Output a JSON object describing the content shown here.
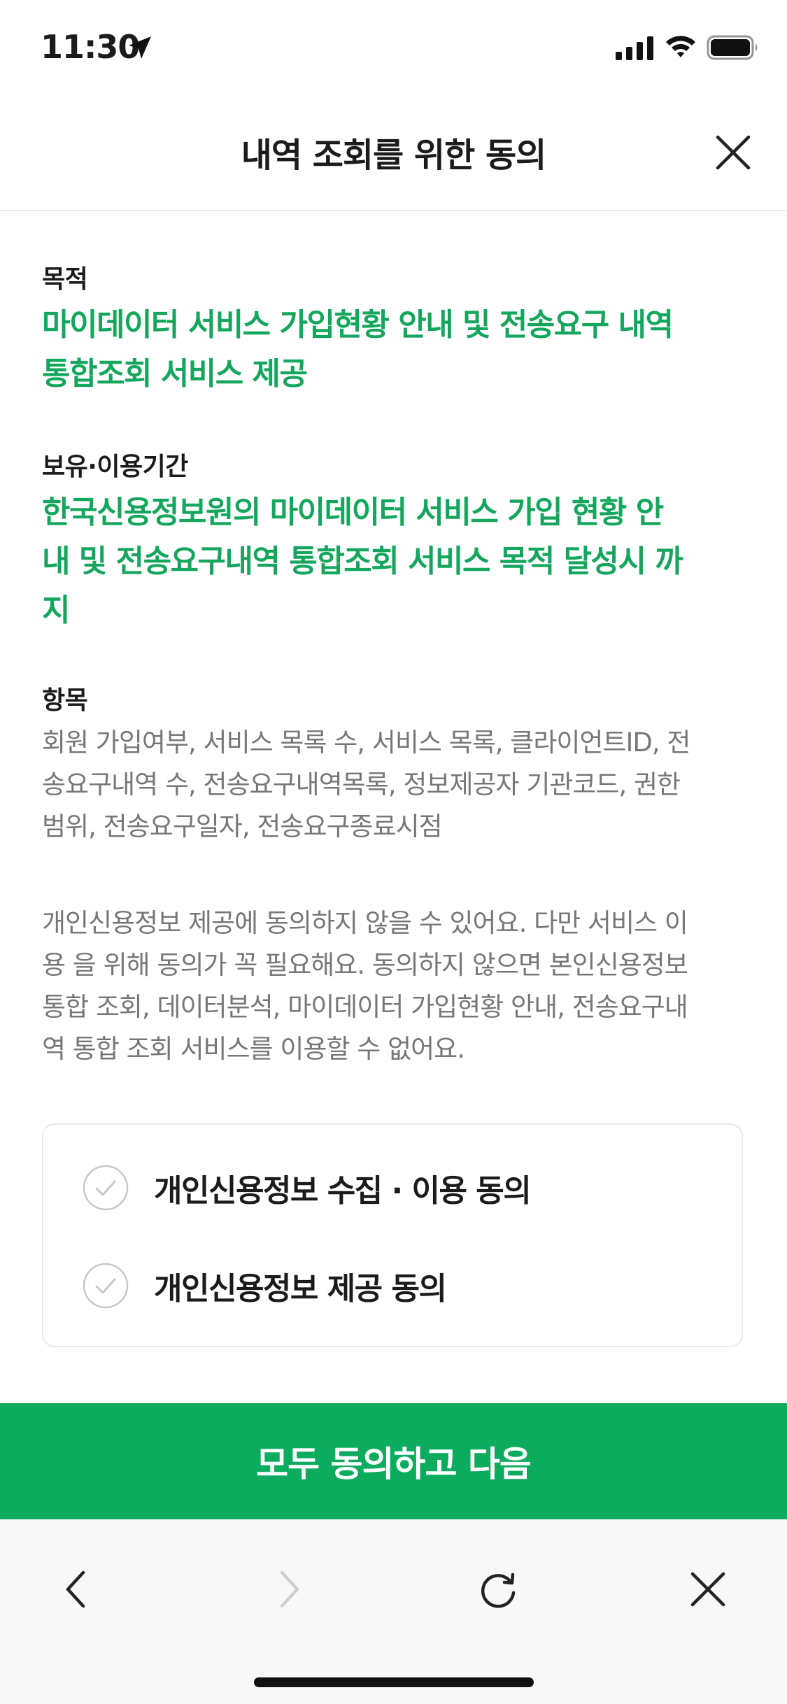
{
  "status_bar": {
    "time": "11:30",
    "icons": [
      "location-arrow-icon",
      "cellular-signal-icon",
      "wifi-icon",
      "battery-icon"
    ]
  },
  "header": {
    "title": "내역 조회를 위한 동의",
    "close_icon": "close-icon"
  },
  "sections": {
    "purpose": {
      "label": "목적",
      "lines": [
        "마이데이터 서비스 가입현황 안내 및 전송요구 내역",
        "통합조회 서비스 제공"
      ]
    },
    "retention": {
      "label": "보유·이용기간",
      "lines": [
        "한국신용정보원의 마이데이터 서비스 가입 현황 안",
        "내 및 전송요구내역 통합조회 서비스 목적 달성시 까",
        "지"
      ]
    },
    "items": {
      "label": "항목",
      "lines": [
        "회원 가입여부, 서비스 목록 수, 서비스 목록, 클라이언트ID, 전",
        "송요구내역 수, 전송요구내역목록, 정보제공자 기관코드, 권한",
        "범위, 전송요구일자, 전송요구종료시점"
      ]
    }
  },
  "notice": {
    "lines": [
      "개인신용정보 제공에 동의하지 않을 수 있어요. 다만 서비스 이",
      "용 을 위해 동의가 꼭 필요해요. 동의하지 않으면 본인신용정보",
      "통합 조회, 데이터분석, 마이데이터 가입현황 안내, 전송요구내",
      "역 통합 조회 서비스를 이용할 수 없어요."
    ]
  },
  "consents": [
    {
      "label": "개인신용정보 수집 · 이용 동의",
      "checked": false
    },
    {
      "label": "개인신용정보 제공 동의",
      "checked": false
    }
  ],
  "primary_button": {
    "label": "모두 동의하고 다음"
  },
  "toolbar": {
    "icons": [
      "back-icon",
      "forward-icon",
      "refresh-icon",
      "close-icon"
    ],
    "forward_enabled": false
  },
  "colors": {
    "accent": "#14a65d",
    "button": "#0cab5e",
    "body_text": "#777777",
    "toolbar_bg": "#f8f8f8"
  }
}
